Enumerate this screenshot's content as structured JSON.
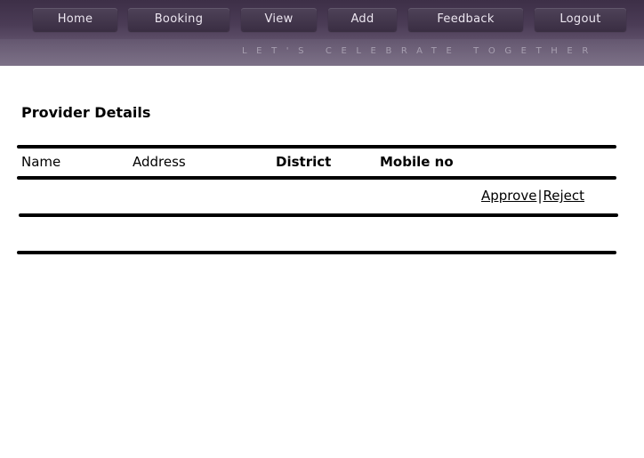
{
  "nav": {
    "items": [
      {
        "label": "Home"
      },
      {
        "label": "Booking"
      },
      {
        "label": "View"
      },
      {
        "label": "Add"
      },
      {
        "label": "Feedback"
      },
      {
        "label": "Logout"
      }
    ]
  },
  "header": {
    "tagline": "LET'S CELEBRATE TOGETHER"
  },
  "main": {
    "title": "Provider Details",
    "table": {
      "columns": [
        "Name",
        "Address",
        "District",
        "Mobile no"
      ],
      "rows": [
        {
          "approve_label": "Approve",
          "separator": "|",
          "reject_label": "Reject"
        }
      ]
    }
  },
  "colors": {
    "header_bg": "#4b3c56",
    "nav_button": "#3a2e43",
    "nav_text": "#ece6f0",
    "tagline": "#a79fb0",
    "rule": "#000000"
  }
}
